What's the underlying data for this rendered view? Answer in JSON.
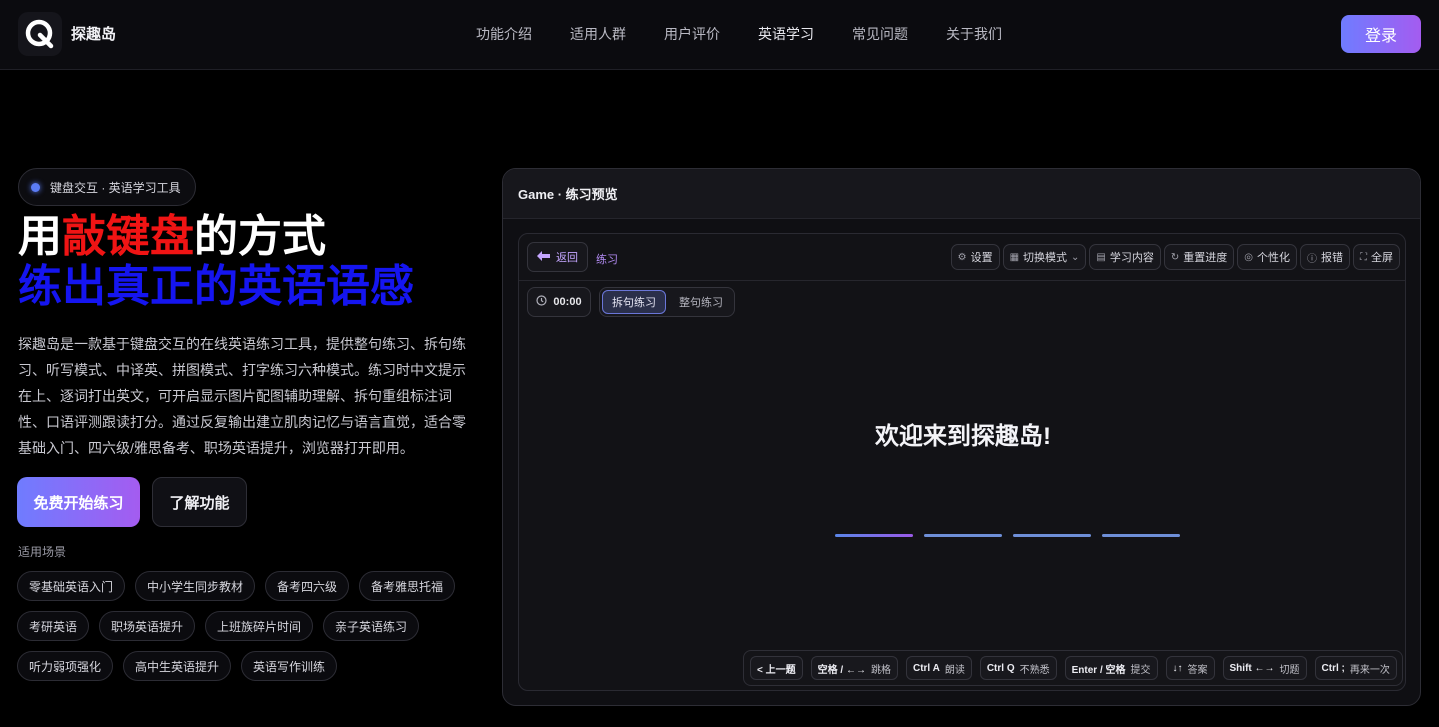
{
  "header": {
    "brand": "探趣岛",
    "nav": [
      "功能介绍",
      "适用人群",
      "用户评价",
      "英语学习",
      "常见问题",
      "关于我们"
    ],
    "active_nav": "英语学习",
    "login_label": "登录"
  },
  "hero": {
    "pill": "键盘交互 · 英语学习工具",
    "title_pre": "用",
    "title_highlight": "敲键盘",
    "title_post": "的方式",
    "subtitle": "练出真正的英语语感",
    "description": "探趣岛是一款基于键盘交互的在线英语练习工具，提供整句练习、拆句练习、听写模式、中译英、拼图模式、打字练习六种模式。练习时中文提示在上、逐词打出英文，可开启显示图片配图辅助理解、拆句重组标注词性、口语评测跟读打分。通过反复输出建立肌肉记忆与语言直觉，适合零基础入门、四六级/雅思备考、职场英语提升，浏览器打开即用。",
    "primary_button": "免费开始练习",
    "secondary_button": "了解功能",
    "scenes_label": "适用场景",
    "tags": [
      [
        "零基础英语入门",
        "中小学生同步教材",
        "备考四六级",
        "备考雅思托福"
      ],
      [
        "考研英语",
        "职场英语提升",
        "上班族碎片时间",
        "亲子英语练习"
      ],
      [
        "听力弱项强化",
        "高中生英语提升",
        "英语写作训练"
      ]
    ],
    "colors": {
      "highlight": "#f01414",
      "subtitle": "#1515f0",
      "accent_start": "#6f7cff",
      "accent_end": "#a45cf0"
    }
  },
  "game": {
    "panel_title": "Game · 练习预览",
    "back_label": "返回",
    "practice_label": "练习",
    "tools": [
      {
        "icon": "settings-icon",
        "label": "设置"
      },
      {
        "icon": "grid-icon",
        "label": "切换模式"
      },
      {
        "icon": "document-icon",
        "label": "学习内容"
      },
      {
        "icon": "refresh-icon",
        "label": "重置进度"
      },
      {
        "icon": "palette-icon",
        "label": "个性化"
      },
      {
        "icon": "alert-icon",
        "label": "报错"
      },
      {
        "icon": "fullscreen-icon",
        "label": "全屏"
      }
    ],
    "timer": "00:00",
    "modes": [
      "拆句练习",
      "整句练习"
    ],
    "selected_mode": "拆句练习",
    "welcome": "欢迎来到探趣岛!",
    "word_slots": 4,
    "shortcuts": [
      {
        "key": "< 上一题",
        "action": ""
      },
      {
        "key": "空格 / ←→",
        "action": "跳格"
      },
      {
        "key": "Ctrl A",
        "action": "朗读"
      },
      {
        "key": "Ctrl Q",
        "action": "不熟悉"
      },
      {
        "key": "Enter / 空格",
        "action": "提交"
      },
      {
        "key": "↓↑",
        "action": "答案"
      },
      {
        "key": "Shift ←→",
        "action": "切题"
      },
      {
        "key": "Ctrl ;",
        "action": "再来一次"
      }
    ]
  }
}
